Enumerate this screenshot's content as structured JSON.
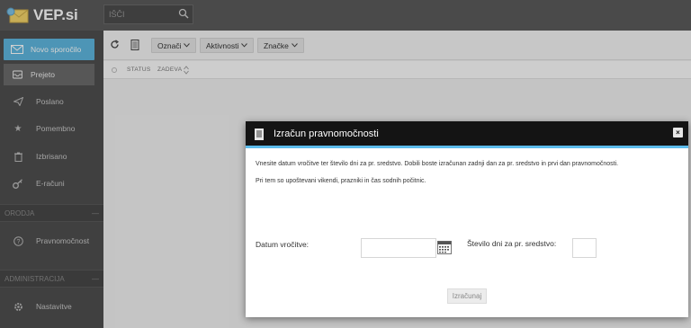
{
  "app": {
    "logo_text": "VEP.si"
  },
  "search": {
    "placeholder": "IŠČI"
  },
  "sidebar": {
    "items": [
      {
        "label": "Novo sporočilo",
        "icon": "envelope-icon"
      },
      {
        "label": "Prejeto",
        "icon": "inbox-icon"
      },
      {
        "label": "Poslano",
        "icon": "send-icon"
      },
      {
        "label": "Pomembno",
        "icon": "star-icon"
      },
      {
        "label": "Izbrisano",
        "icon": "trash-icon"
      },
      {
        "label": "E-računi",
        "icon": "key-icon"
      }
    ],
    "sections": [
      {
        "label": "ORODJA",
        "toggle": "—",
        "items": [
          {
            "label": "Pravnomočnost",
            "icon": "help-circle-icon"
          }
        ]
      },
      {
        "label": "ADMINISTRACIJA",
        "toggle": "—",
        "items": [
          {
            "label": "Nastavitve",
            "icon": "gear-icon"
          }
        ]
      }
    ]
  },
  "toolbar": {
    "buttons": [
      {
        "label": "Označi"
      },
      {
        "label": "Aktivnosti"
      },
      {
        "label": "Značke"
      }
    ]
  },
  "table": {
    "columns": [
      "STATUS",
      "ZADEVA"
    ]
  },
  "modal": {
    "title": "Izračun pravnomočnosti",
    "close": "×",
    "description": "Vnesite datum vročitve ter število dni za pr. sredstvo. Dobili boste izračunan zadnji dan za pr. sredstvo in prvi dan pravnomočnosti.",
    "note": "Pri tem so upoštevani vikendi, prazniki in čas sodnih počitnic.",
    "date_label": "Datum vročitve:",
    "date_value": "",
    "days_label": "Število dni za pr. sredstvo:",
    "days_value": "",
    "calculate_label": "Izračunaj"
  },
  "colors": {
    "accent": "#5cbcec",
    "primary_button": "#5fb6de",
    "sidebar": "#4f4f4f",
    "topbar": "#5b5b5b"
  }
}
